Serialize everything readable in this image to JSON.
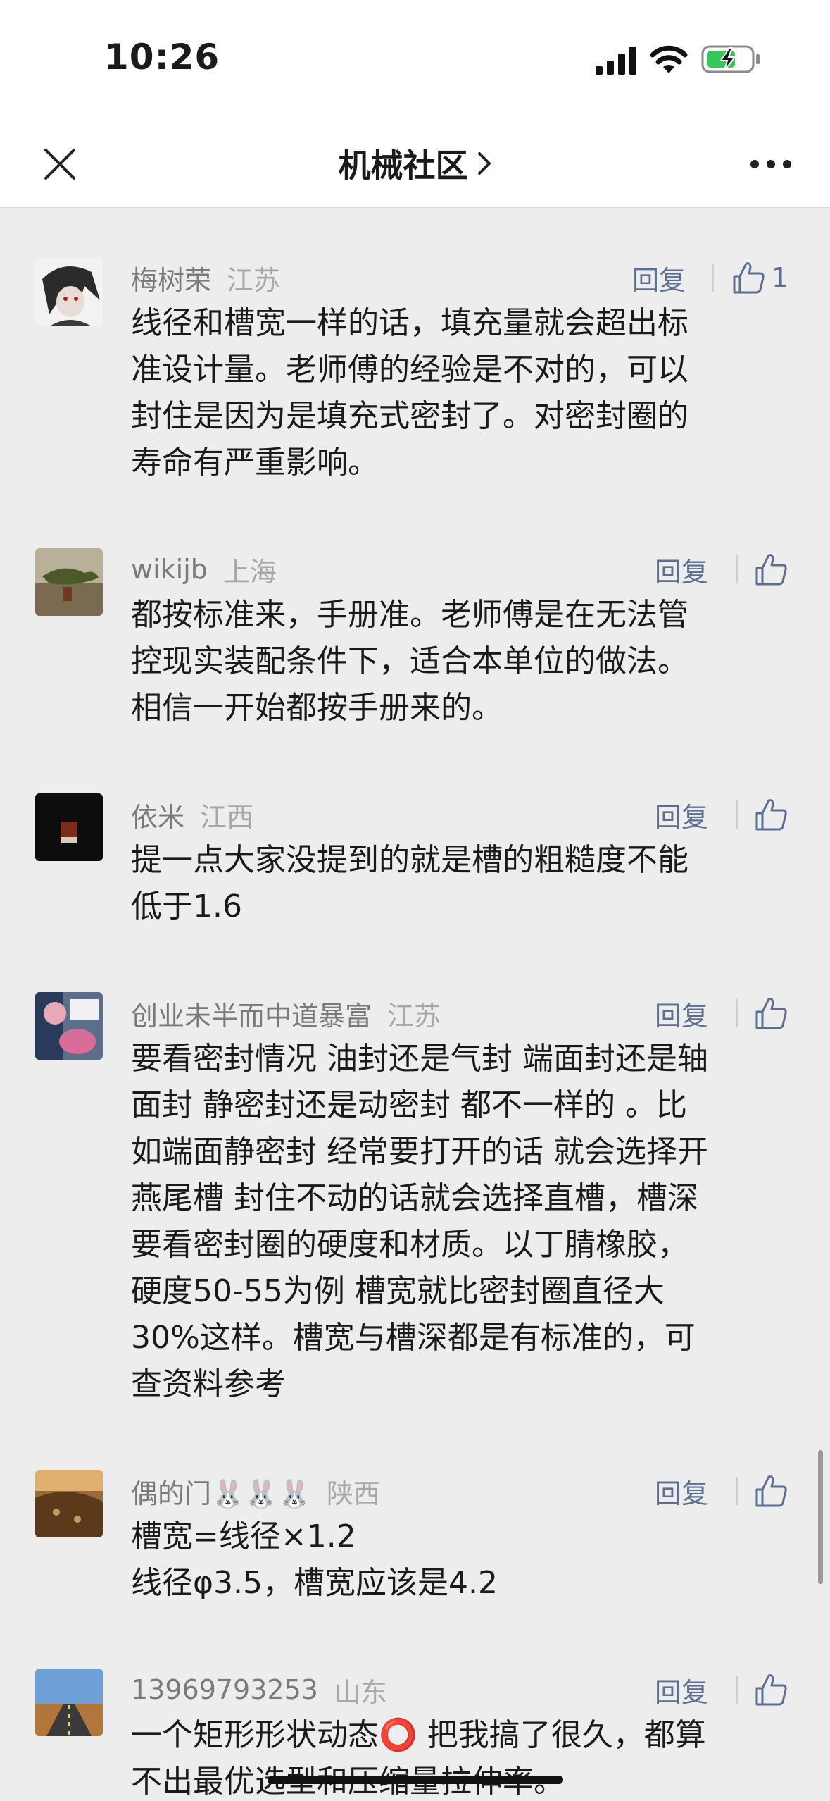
{
  "status_bar": {
    "time": "10:26"
  },
  "nav": {
    "title": "机械社区"
  },
  "comments": [
    {
      "author": "梅树荣",
      "region": "江苏",
      "reply": "回复",
      "likes": "1",
      "lines": [
        "线径和槽宽一样的话，填充量就会超出标",
        "准设计量。老师傅的经验是不对的，可以",
        "封住是因为是填充式密封了。对密封圈的",
        "寿命有严重影响。"
      ]
    },
    {
      "author": "wikijb",
      "region": "上海",
      "reply": "回复",
      "likes": "",
      "lines": [
        "都按标准来，手册准。老师傅是在无法管",
        "控现实装配条件下，适合本单位的做法。",
        "相信一开始都按手册来的。"
      ]
    },
    {
      "author": "依米",
      "region": "江西",
      "reply": "回复",
      "likes": "",
      "lines": [
        "提一点大家没提到的就是槽的粗糙度不能",
        "低于1.6"
      ]
    },
    {
      "author": "创业未半而中道暴富",
      "region": "江苏",
      "reply": "回复",
      "likes": "",
      "lines": [
        "要看密封情况 油封还是气封 端面封还是轴",
        "面封 静密封还是动密封 都不一样的 。比",
        "如端面静密封 经常要打开的话 就会选择开",
        "燕尾槽 封住不动的话就会选择直槽，槽深",
        "要看密封圈的硬度和材质。以丁腈橡胶，",
        "硬度50-55为例 槽宽就比密封圈直径大",
        "30%这样。槽宽与槽深都是有标准的，可",
        "查资料参考"
      ]
    },
    {
      "author": "偶的门🐰🐰🐰",
      "region": "陕西",
      "reply": "回复",
      "likes": "",
      "lines": [
        "槽宽=线径×1.2",
        "线径φ3.5，槽宽应该是4.2"
      ]
    },
    {
      "author": "13969793253",
      "region": "山东",
      "reply": "回复",
      "likes": "",
      "lines": [
        "一个矩形形状动态⭕️ 把我搞了很久，都算",
        "不出最优选型和压缩量拉伸率。"
      ]
    }
  ]
}
